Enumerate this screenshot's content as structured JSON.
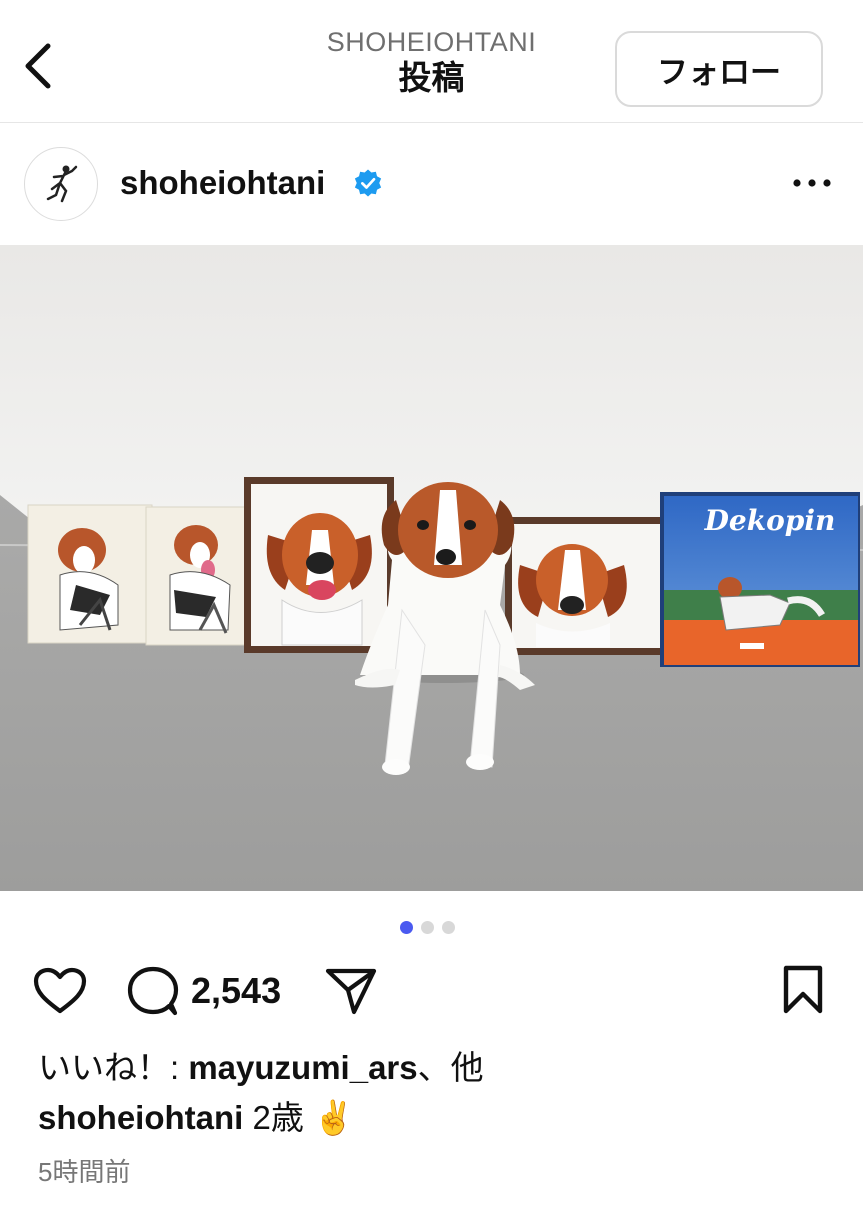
{
  "header": {
    "username": "SHOHEIOHTANI",
    "title": "投稿",
    "follow_label": "フォロー"
  },
  "post": {
    "username": "shoheiohtani",
    "verified": true,
    "photo_caption_text": "Dekopin",
    "carousel": {
      "count": 3,
      "active_index": 0
    },
    "comment_count": "2,543",
    "likes_prefix": "いいね！: ",
    "likes_user": "mayuzumi_ars",
    "likes_suffix": "、他",
    "caption_user": "shoheiohtani",
    "caption_text": " 2歳 ✌️",
    "time_ago": "5時間前"
  },
  "icons": [
    "back-chevron-icon",
    "more-options-icon",
    "verified-badge-icon",
    "heart-icon",
    "comment-icon",
    "share-icon",
    "bookmark-icon"
  ],
  "colors": {
    "verified_blue": "#1d9bf0",
    "dot_active": "#4a5af0",
    "dot_inactive": "#d8d8d8"
  }
}
